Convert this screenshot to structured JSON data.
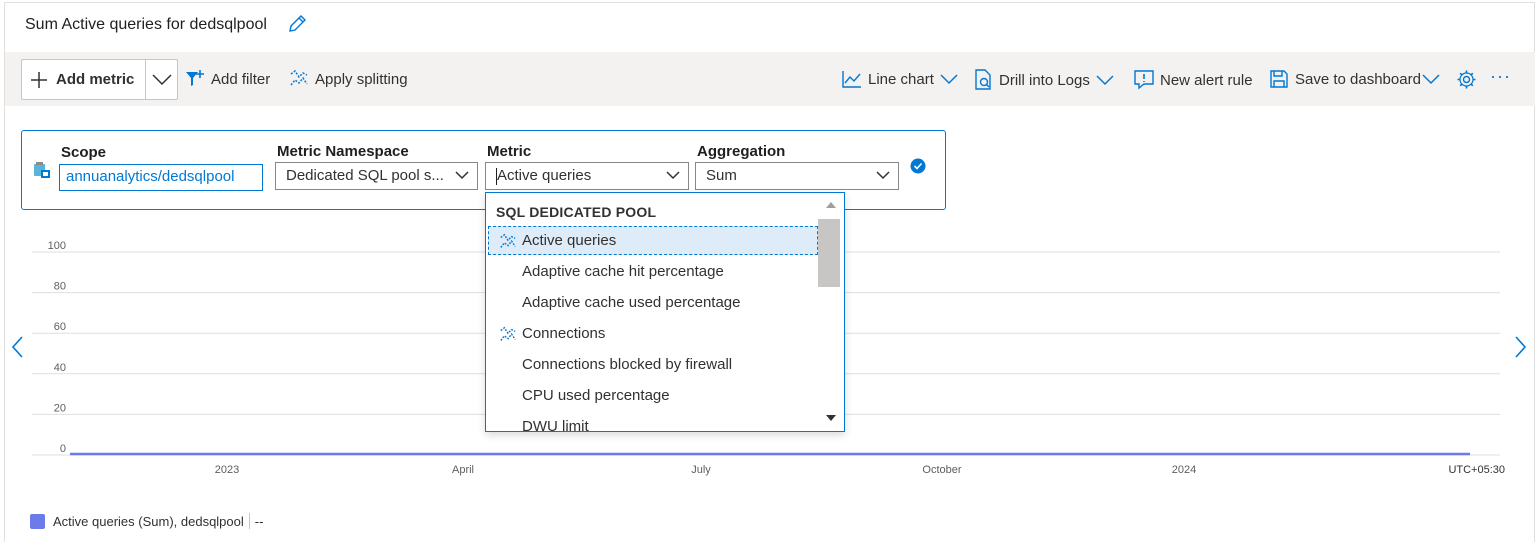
{
  "title": "Sum Active queries for dedsqlpool",
  "toolbar": {
    "add_metric": "Add metric",
    "add_filter": "Add filter",
    "apply_splitting": "Apply splitting",
    "line_chart": "Line chart",
    "drill_into_logs": "Drill into Logs",
    "new_alert_rule": "New alert rule",
    "save_to_dashboard": "Save to dashboard",
    "more": "···"
  },
  "metric_row": {
    "scope_label": "Scope",
    "scope_value": "annuanalytics/dedsqlpool",
    "namespace_label": "Metric Namespace",
    "namespace_value": "Dedicated SQL pool s...",
    "metric_label": "Metric",
    "metric_value": "Active queries",
    "aggregation_label": "Aggregation",
    "aggregation_value": "Sum"
  },
  "dropdown": {
    "header": "SQL DEDICATED POOL",
    "items": [
      {
        "label": "Active queries",
        "icon": "split-icon",
        "selected": true
      },
      {
        "label": "Adaptive cache hit percentage",
        "icon": "",
        "selected": false
      },
      {
        "label": "Adaptive cache used percentage",
        "icon": "",
        "selected": false
      },
      {
        "label": "Connections",
        "icon": "split-icon",
        "selected": false
      },
      {
        "label": "Connections blocked by firewall",
        "icon": "",
        "selected": false
      },
      {
        "label": "CPU used percentage",
        "icon": "",
        "selected": false
      },
      {
        "label": "DWU limit",
        "icon": "",
        "selected": false
      }
    ]
  },
  "chart_data": {
    "type": "line",
    "y_ticks": [
      "100",
      "80",
      "60",
      "40",
      "20",
      "0"
    ],
    "ylim": [
      0,
      100
    ],
    "x_ticks": [
      "2023",
      "April",
      "July",
      "October",
      "2024"
    ],
    "timezone": "UTC+05:30",
    "series": [
      {
        "name": "Active queries (Sum), dedsqlpool",
        "values": [
          0,
          0
        ],
        "color": "#6b7cea"
      }
    ],
    "legend_value": "--"
  },
  "colors": {
    "accent": "#0078d4",
    "series": "#6b7cea"
  }
}
